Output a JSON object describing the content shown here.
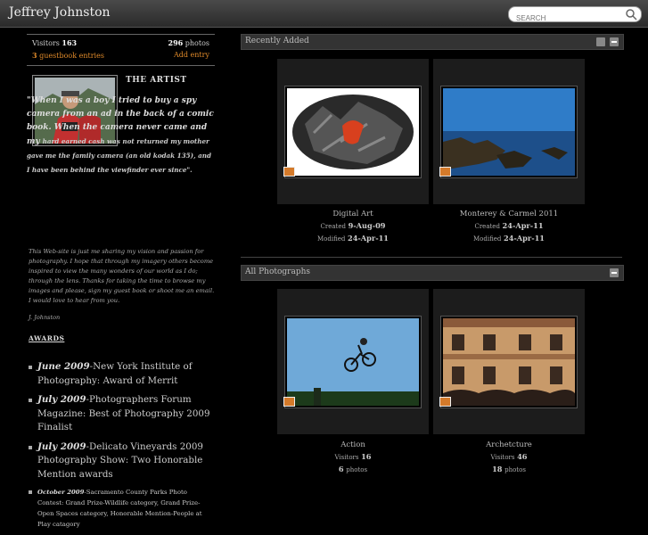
{
  "header": {
    "site_title": "Jeffrey Johnston",
    "search_placeholder": "SEARCH"
  },
  "stats": {
    "visitors_label": "Visitors",
    "visitors_value": "163",
    "photos_value": "296",
    "photos_label": "photos",
    "guestbook_count": "3",
    "guestbook_label": "guestbook entries",
    "add_entry": "Add entry"
  },
  "artist": {
    "heading": "THE ARTIST",
    "quote_big": "\"When I was a boy I tried to buy a spy camera from an ad in the back of a comic book. When the camera never came and my",
    "quote_small": "hard earned cash was not returned my mother gave me the family camera (an old kodak 135), and I have been behind the viewfinder ever since\".",
    "bio": "This Web-site is just me sharing my vision and passion for photography. I hope that through my imagery others become inspired to view the many wonders of our world as I do; through the lens. Thanks for taking the time to browse my images and please, sign my guest book or shoot me an email. I would love to hear from you.",
    "signature": "J. Johnston"
  },
  "awards": {
    "heading": "AWARDS",
    "items": [
      {
        "year": "June 2009",
        "text": "-New York Institute of Photography: Award of Merrit"
      },
      {
        "year": "July 2009",
        "text": "-Photographers Forum Magazine: Best of Photography 2009 Finalist"
      },
      {
        "year": "July 2009",
        "text": "-Delicato Vineyards 2009 Photography Show: Two Honorable Mention awards"
      },
      {
        "year": "October 2009",
        "text": "-Sacramento County Parks Photo Contest: Grand Prize-Wildlife category, Grand Prize-Open Spaces category, Honorable Mention-People at Play catagory"
      }
    ]
  },
  "recent": {
    "title": "Recently Added",
    "items": [
      {
        "name": "Digital Art",
        "created_label": "Created",
        "created": "9-Aug-09",
        "modified_label": "Modified",
        "modified": "24-Apr-11"
      },
      {
        "name": "Monterey & Carmel 2011",
        "created_label": "Created",
        "created": "24-Apr-11",
        "modified_label": "Modified",
        "modified": "24-Apr-11"
      }
    ]
  },
  "all": {
    "title": "All Photographs",
    "items": [
      {
        "name": "Action",
        "visitors_label": "Visitors",
        "visitors": "16",
        "photos": "6",
        "photos_label": "photos"
      },
      {
        "name": "Archetcture",
        "visitors_label": "Visitors",
        "visitors": "46",
        "photos": "18",
        "photos_label": "photos"
      }
    ]
  },
  "icons": {
    "search": "search-icon",
    "rss": "rss-icon",
    "collapse": "collapse-icon",
    "gallery_badge": "gallery-badge-icon"
  }
}
